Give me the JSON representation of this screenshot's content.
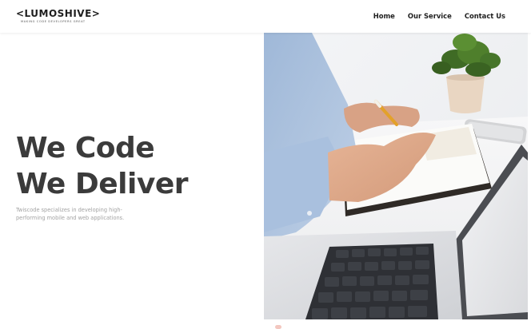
{
  "brand": {
    "name": "<LUMOSHIVE>",
    "tagline": "MAKING CODE DEVELOPERS GREAT"
  },
  "nav": {
    "items": [
      {
        "label": "Home"
      },
      {
        "label": "Our Service"
      },
      {
        "label": "Contact Us"
      }
    ]
  },
  "hero": {
    "title_line1": "We Code",
    "title_line2": "We Deliver",
    "description": "Twiscode specializes in developing high-performing mobile and web applications."
  },
  "colors": {
    "heading": "#3b3b3b",
    "muted_text": "#a3a3a3",
    "nav_text": "#1f1f1f",
    "background": "#ffffff"
  },
  "image": {
    "icon": "workspace-photo"
  }
}
